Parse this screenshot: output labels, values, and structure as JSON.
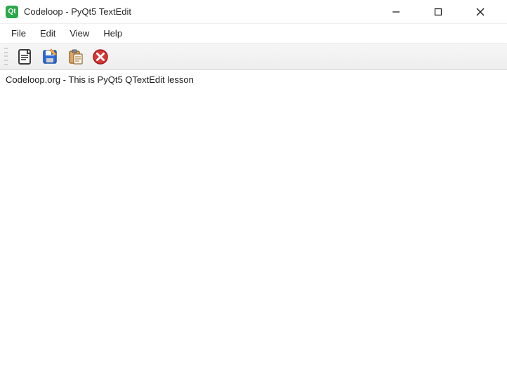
{
  "window": {
    "title": "Codeloop - PyQt5 TextEdit",
    "app_icon_label": "Qt"
  },
  "menubar": {
    "items": [
      "File",
      "Edit",
      "View",
      "Help"
    ]
  },
  "toolbar": {
    "icons": [
      {
        "name": "new-doc-icon"
      },
      {
        "name": "save-icon"
      },
      {
        "name": "paste-icon"
      },
      {
        "name": "close-icon"
      }
    ]
  },
  "editor": {
    "content": "Codeloop.org - This is PyQt5 QTextEdit lesson"
  }
}
